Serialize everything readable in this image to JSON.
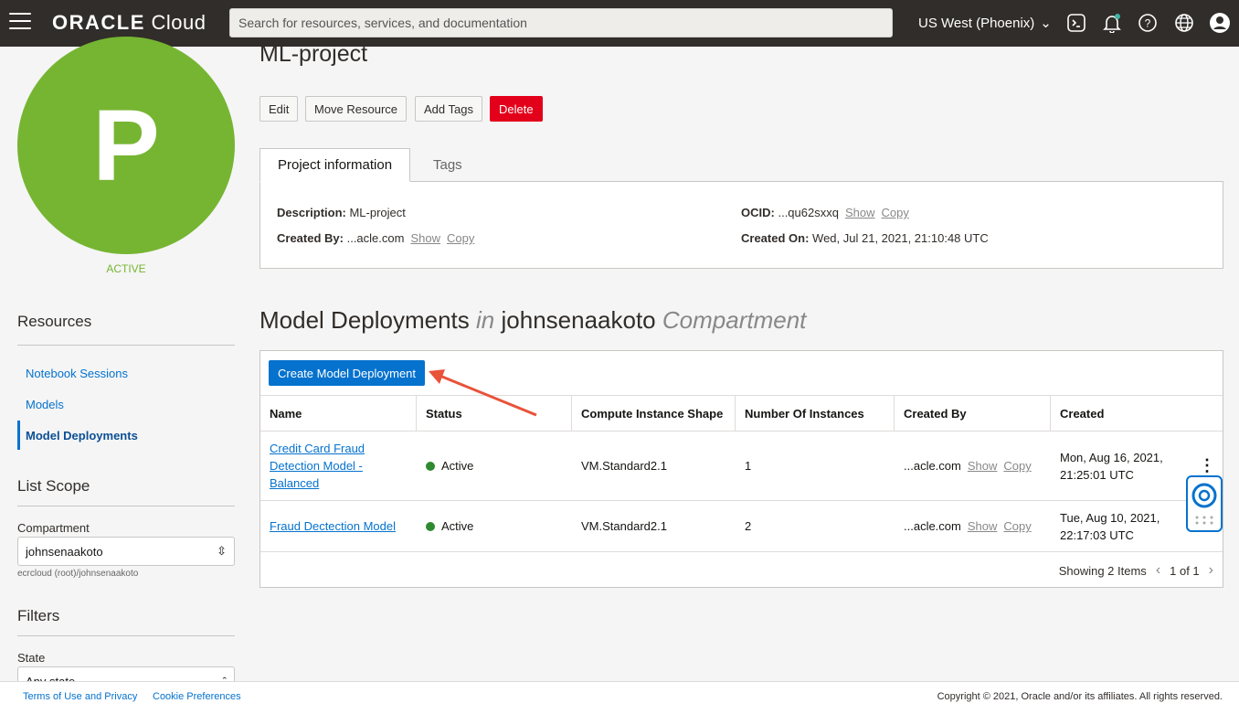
{
  "header": {
    "logo_brand": "ORACLE",
    "logo_product": "Cloud",
    "search_placeholder": "Search for resources, services, and documentation",
    "region": "US West (Phoenix)"
  },
  "project": {
    "avatar_letter": "P",
    "status": "ACTIVE",
    "title": "ML-project",
    "actions": [
      "Edit",
      "Move Resource",
      "Add Tags",
      "Delete"
    ],
    "tabs": [
      "Project information",
      "Tags"
    ],
    "info": {
      "description_label": "Description:",
      "description_value": "ML-project",
      "created_by_label": "Created By:",
      "created_by_value": "...acle.com",
      "ocid_label": "OCID:",
      "ocid_value": "...qu62sxxq",
      "created_on_label": "Created On:",
      "created_on_value": "Wed, Jul 21, 2021, 21:10:48 UTC",
      "show": "Show",
      "copy": "Copy"
    }
  },
  "sidebar": {
    "resources_heading": "Resources",
    "items": [
      "Notebook Sessions",
      "Models",
      "Model Deployments"
    ],
    "active_item": "Model Deployments",
    "list_scope_heading": "List Scope",
    "compartment_label": "Compartment",
    "compartment_value": "johnsenaakoto",
    "compartment_path": "ecrcloud (root)/johnsenaakoto",
    "filters_heading": "Filters",
    "state_label": "State",
    "state_value": "Any state"
  },
  "deployments": {
    "title_main": "Model Deployments",
    "title_in": "in",
    "title_compartment": "johnsenaakoto",
    "title_suffix": "Compartment",
    "create_button": "Create Model Deployment",
    "columns": [
      "Name",
      "Status",
      "Compute Instance Shape",
      "Number Of Instances",
      "Created By",
      "Created"
    ],
    "rows": [
      {
        "name_lines": [
          "Credit Card Fraud",
          "Detection Model -",
          "Balanced"
        ],
        "status": "Active",
        "shape": "VM.Standard2.1",
        "instances": "1",
        "created_by": "...acle.com",
        "created_line1": "Mon, Aug 16, 2021,",
        "created_line2": "21:25:01 UTC"
      },
      {
        "name_lines": [
          "Fraud Dectection Model"
        ],
        "status": "Active",
        "shape": "VM.Standard2.1",
        "instances": "2",
        "created_by": "...acle.com",
        "created_line1": "Tue, Aug 10, 2021,",
        "created_line2": "22:17:03 UTC"
      }
    ],
    "show": "Show",
    "copy": "Copy",
    "showing": "Showing 2 Items",
    "page": "1 of 1"
  },
  "footer": {
    "terms": "Terms of Use and Privacy",
    "cookies": "Cookie Preferences",
    "copyright": "Copyright © 2021, Oracle and/or its affiliates. All rights reserved."
  },
  "colors": {
    "header_bg": "#312d2a",
    "accent": "#0572ce",
    "active_green": "#76b532",
    "danger": "#e3001b",
    "arrow": "#e8533a"
  }
}
